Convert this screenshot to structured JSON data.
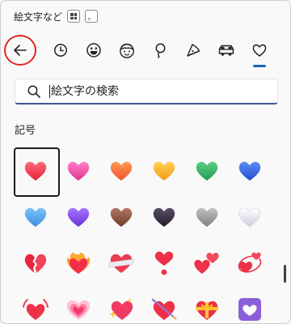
{
  "title": "絵文字など",
  "shortcut_keys": [
    "windows-logo-key",
    "。"
  ],
  "tabs": [
    {
      "name": "back",
      "icon": "back-arrow-icon"
    },
    {
      "name": "recent",
      "icon": "clock-icon"
    },
    {
      "name": "emoji",
      "icon": "smiley-icon"
    },
    {
      "name": "people",
      "icon": "face-icon"
    },
    {
      "name": "celebration",
      "icon": "balloon-icon"
    },
    {
      "name": "food",
      "icon": "pizza-icon"
    },
    {
      "name": "travel",
      "icon": "car-icon"
    },
    {
      "name": "symbols",
      "icon": "heart-outline-icon",
      "active": true
    }
  ],
  "search": {
    "placeholder": "絵文字の検索",
    "value": ""
  },
  "section_title": "記号",
  "emoji_rows": [
    [
      "red-heart",
      "pink-heart",
      "orange-heart",
      "yellow-heart",
      "green-heart",
      "blue-heart"
    ],
    [
      "light-blue-heart",
      "purple-heart",
      "brown-heart",
      "black-heart",
      "grey-heart",
      "white-heart"
    ],
    [
      "broken-heart",
      "heart-on-fire",
      "mending-heart",
      "heart-exclamation",
      "two-hearts",
      "revolving-hearts"
    ],
    [
      "beating-heart",
      "growing-heart",
      "sparkling-heart",
      "heart-with-arrow",
      "heart-with-ribbon",
      "heart-decoration"
    ]
  ],
  "selected_emoji": "red-heart",
  "colors": {
    "accent": "#1a62b8",
    "back_ring": "#e0261b",
    "red": "#f0364a",
    "pink": "#ee4aa7",
    "orange": "#ff7a3d",
    "yellow": "#fbb936",
    "green": "#3bb56a",
    "blue": "#3b6fe0",
    "lightblue": "#58a9f0",
    "purple": "#8a4fe6",
    "brown": "#8a5544",
    "black": "#3a3440",
    "grey": "#9a9a9e",
    "white": "#ecebf2"
  }
}
